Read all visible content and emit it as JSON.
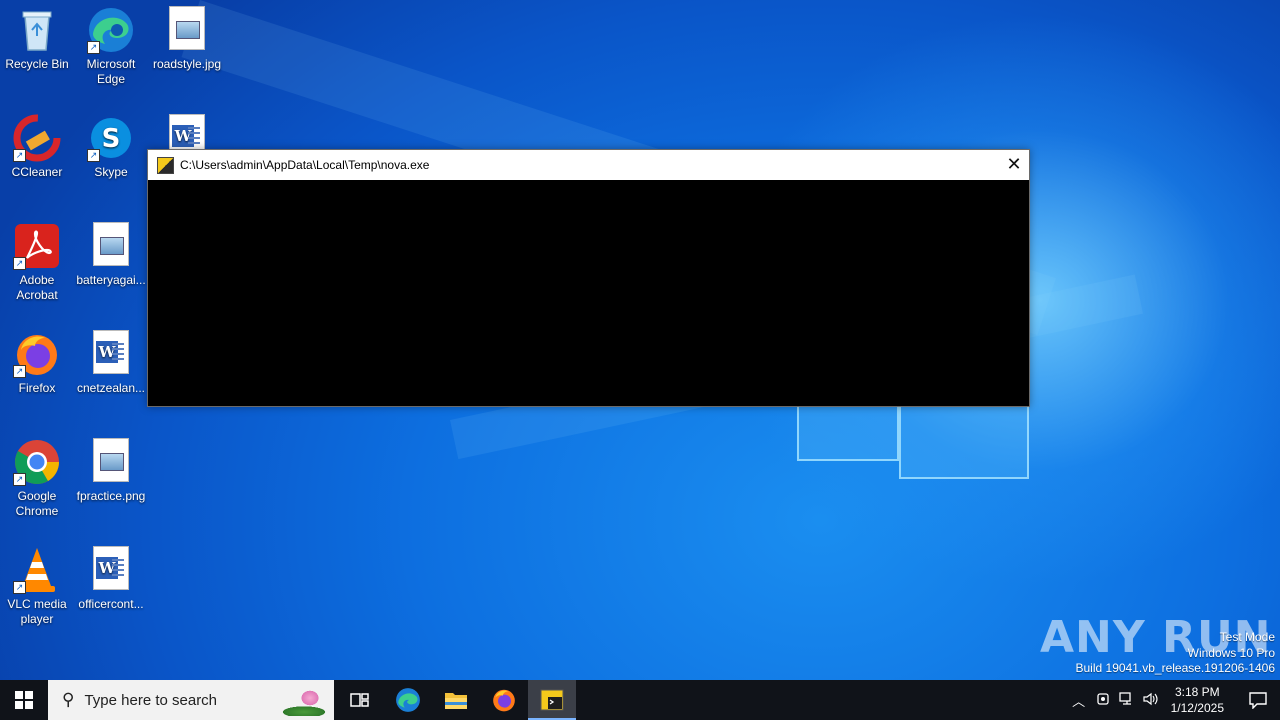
{
  "desktop": {
    "icons": [
      {
        "label": "Recycle Bin"
      },
      {
        "label": "Microsoft Edge"
      },
      {
        "label": "roadstyle.jpg"
      },
      {
        "label": "CCleaner"
      },
      {
        "label": "Skype"
      },
      {
        "label": "Adobe Acrobat"
      },
      {
        "label": "batteryagai..."
      },
      {
        "label": "Firefox"
      },
      {
        "label": "cnetzealan..."
      },
      {
        "label": "Google Chrome"
      },
      {
        "label": "fpractice.png"
      },
      {
        "label": "VLC media player"
      },
      {
        "label": "officercont..."
      }
    ]
  },
  "console_window": {
    "title": "C:\\Users\\admin\\AppData\\Local\\Temp\\nova.exe",
    "close_glyph": "✕",
    "icon": "console-app-icon"
  },
  "watermark": {
    "brand": "ANY RUN",
    "test_mode": "Test Mode",
    "edition": "Windows 10 Pro",
    "build": "Build 19041.vb_release.191206-1406"
  },
  "taskbar": {
    "search_placeholder": "Type here to search",
    "pinned": [
      "task-view",
      "microsoft-edge",
      "file-explorer",
      "firefox",
      "nova-console"
    ],
    "active_app": "nova-console",
    "clock_time": "3:18 PM",
    "clock_date": "1/12/2025",
    "tray_icons": [
      "chevron-up-icon",
      "device-icon",
      "network-icon",
      "volume-icon"
    ]
  },
  "colors": {
    "taskbar_bg": "#101319",
    "console_bg": "#000000",
    "accent": "#7ab4ff"
  }
}
